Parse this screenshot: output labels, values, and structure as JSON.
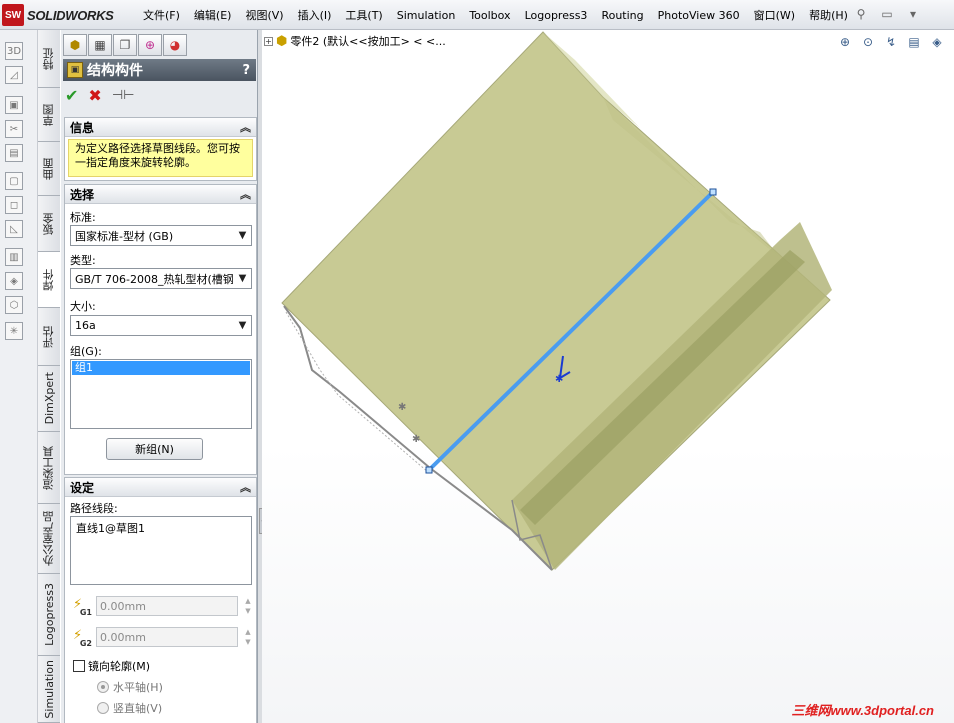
{
  "app": {
    "logo_badge": "SW",
    "logo_text": "SOLIDWORKS"
  },
  "menu": [
    "文件(F)",
    "编辑(E)",
    "视图(V)",
    "插入(I)",
    "工具(T)",
    "Simulation",
    "Toolbox",
    "Logopress3",
    "Routing",
    "PhotoView 360",
    "窗口(W)",
    "帮助(H)"
  ],
  "left_tabs": [
    "特征",
    "草图",
    "曲面",
    "钣金",
    "焊件",
    "评估",
    "DimXpert",
    "渲染工具",
    "办公室产品",
    "Logopress3",
    "Simulation"
  ],
  "pm": {
    "title": "结构构件",
    "help": "?",
    "info": {
      "header": "信息",
      "message": "为定义路径选择草图线段。您可按一指定角度来旋转轮廓。"
    },
    "selection": {
      "header": "选择",
      "standard_label": "标准:",
      "standard_value": "国家标准-型材 (GB)",
      "type_label": "类型:",
      "type_value": "GB/T 706-2008_热轧型材(槽钢",
      "size_label": "大小:",
      "size_value": "16a",
      "group_label": "组(G):",
      "group_item": "组1",
      "new_group_button": "新组(N)"
    },
    "settings": {
      "header": "设定",
      "path_label": "路径线段:",
      "path_value": "直线1@草图1",
      "gap1_value": "0.00mm",
      "gap1_tag": "G1",
      "gap2_value": "0.00mm",
      "gap2_tag": "G2",
      "mirror_label": "镜向轮廓(M)",
      "horizontal_label": "水平轴(H)",
      "vertical_label": "竖直轴(V)"
    }
  },
  "viewport": {
    "tree_text": "零件2  (默认<<按加工> < <...",
    "watermark": "三维网www.3dportal.cn"
  },
  "colors": {
    "model_face": "#c8ca94",
    "path_line": "#4a9cf0"
  }
}
